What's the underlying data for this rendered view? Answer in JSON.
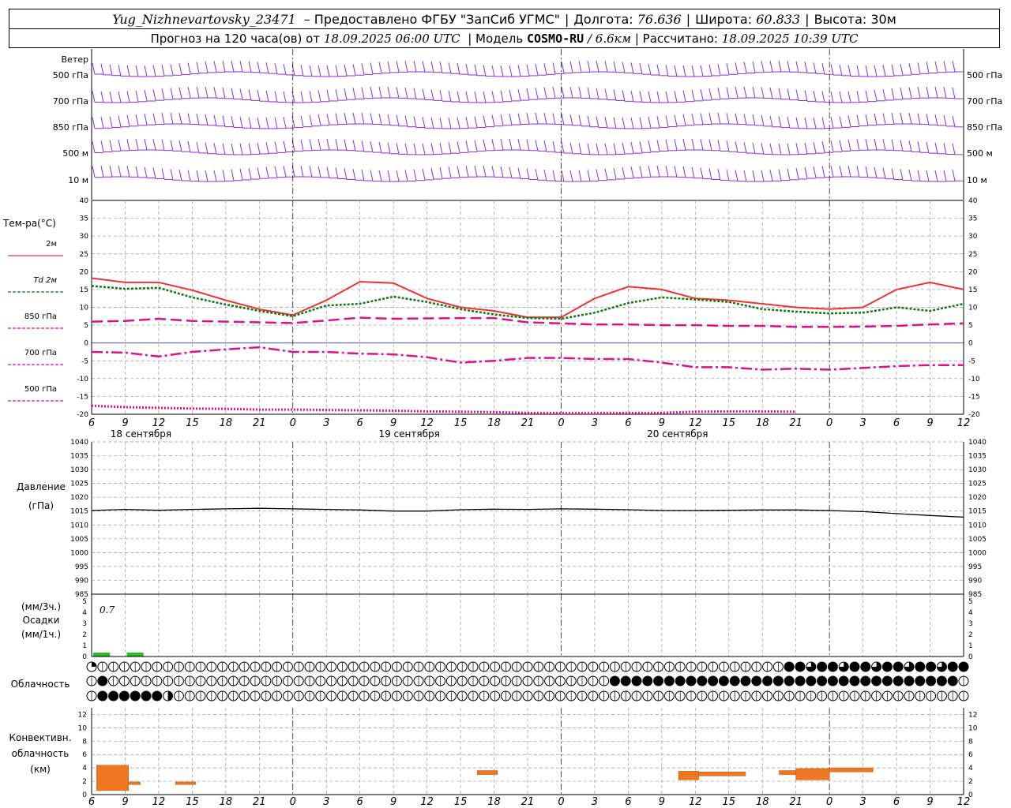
{
  "header": {
    "station": "Yug_Nizhnevartovsky_23471",
    "provider": "– Предоставлено ФГБУ \"ЗапСиб УГМС\"",
    "lon_label": "Долгота:",
    "lon": "76.636",
    "lat_label": "Широта:",
    "lat": "60.833",
    "alt_label": "Высота:",
    "alt": "30м",
    "forecast_prefix": "Прогноз на 120 часа(ов) от",
    "forecast_start": "18.09.2025 06:00 UTC",
    "model_label": "| Модель",
    "model": "COSMO-RU",
    "res": "/ 6.6км",
    "calc_label": "| Рассчитано:",
    "calc": "18.09.2025 10:39 UTC"
  },
  "labels": {
    "wind": "Ветер",
    "wind_levels": [
      "500 гПа",
      "700 гПа",
      "850 гПа",
      "500 м",
      "10  м"
    ],
    "temp_title": "Тем-ра(°C)",
    "temp_series": [
      "2м",
      "Td  2м",
      "850 гПа",
      "700 гПа",
      "500 гПа"
    ],
    "pressure_title": "Давление",
    "pressure_unit": "(гПа)",
    "precip_top": "(мм/3ч.)",
    "precip_mid": "Осадки",
    "precip_bot": "(мм/1ч.)",
    "precip_total": "0.7",
    "cloud": "Облачность",
    "conv1": "Конвективн.",
    "conv2": "облачность",
    "conv3": "(км)"
  },
  "colors": {
    "t2m": "#ee3333",
    "td2m": "#117711",
    "t850": "#dd1188",
    "t700": "#dd1188",
    "t500": "#dd1188",
    "wind": "#8a2be2",
    "precip": "#22bb22",
    "conv": "#ee7722",
    "grid": "#999999"
  },
  "chart_data": {
    "type": "line",
    "x_hours_utc": [
      6,
      9,
      12,
      15,
      18,
      21,
      0,
      3,
      6,
      9,
      12,
      15,
      18,
      21,
      0,
      3,
      6,
      9,
      12,
      15,
      18,
      21,
      0,
      3,
      6,
      9,
      12
    ],
    "x_tick_labels": [
      "6",
      "9",
      "12",
      "15",
      "18",
      "21",
      "0",
      "3",
      "6",
      "9",
      "12",
      "15",
      "18",
      "21",
      "0",
      "3",
      "6",
      "9",
      "12",
      "15",
      "18",
      "21",
      "0",
      "3",
      "6",
      "9",
      "12"
    ],
    "day_labels": [
      "18 сентября",
      "19 сентября",
      "20 сентября"
    ],
    "temperature": {
      "ylim": [
        -20,
        40
      ],
      "yticks": [
        -20,
        -15,
        -10,
        -5,
        0,
        5,
        10,
        15,
        20,
        25,
        30,
        35,
        40
      ],
      "series": [
        {
          "name": "2м",
          "values": [
            18.2,
            17,
            17,
            14.8,
            12,
            9.5,
            7.8,
            12,
            17.2,
            16.8,
            12.5,
            10,
            9,
            7.2,
            7.2,
            12.5,
            15.8,
            15,
            12.5,
            12,
            11,
            10,
            9.5,
            10,
            15,
            17,
            15
          ]
        },
        {
          "name": "Td  2м",
          "values": [
            16,
            15.2,
            15.5,
            12.8,
            10.8,
            9,
            7.5,
            10.5,
            11,
            13,
            11.5,
            9.5,
            8,
            7,
            6.8,
            8.5,
            11.2,
            12.8,
            12.2,
            11.5,
            9.5,
            8.8,
            8.3,
            8.5,
            10,
            9,
            11
          ]
        },
        {
          "name": "850 гПа",
          "values": [
            6,
            6.2,
            6.8,
            6.2,
            6,
            5.8,
            5.6,
            6.3,
            7.1,
            6.8,
            6.9,
            7,
            7,
            5.8,
            5.5,
            5.2,
            5.2,
            5,
            5,
            4.8,
            4.8,
            4.5,
            4.5,
            4.6,
            4.8,
            5.2,
            5.5
          ]
        },
        {
          "name": "700 гПа",
          "values": [
            -2.5,
            -2.7,
            -3.8,
            -2.5,
            -1.8,
            -1.2,
            -2.5,
            -2.5,
            -3,
            -3.2,
            -4,
            -5.5,
            -5,
            -4.2,
            -4.2,
            -4.5,
            -4.5,
            -5.5,
            -6.8,
            -6.8,
            -7.5,
            -7.2,
            -7.5,
            -7,
            -6.5,
            -6.2,
            -6.2
          ]
        },
        {
          "name": "500 гПа",
          "values": [
            -17.6,
            -18,
            -18.2,
            -18.4,
            -18.5,
            -18.7,
            -18.7,
            -18.8,
            -18.9,
            -19,
            -19.2,
            -19.3,
            -19.4,
            -19.6,
            -19.7,
            -19.7,
            -19.6,
            -19.6,
            -19.3,
            -19.2,
            -19.2,
            -19.3,
            null,
            null,
            null,
            null,
            null
          ]
        }
      ]
    },
    "pressure": {
      "ylim": [
        985,
        1040
      ],
      "yticks": [
        985,
        990,
        995,
        1000,
        1005,
        1010,
        1015,
        1020,
        1025,
        1030,
        1035,
        1040
      ],
      "values": [
        1015.2,
        1015.6,
        1015.3,
        1015.6,
        1015.8,
        1016,
        1015.8,
        1015.6,
        1015.4,
        1015,
        1015,
        1015.5,
        1015.7,
        1015.6,
        1015.8,
        1015.7,
        1015.5,
        1015.2,
        1015.2,
        1015.3,
        1015.4,
        1015.4,
        1015.2,
        1014.8,
        1014.1,
        1013.4,
        1012.8
      ]
    },
    "precipitation": {
      "ylim": [
        0,
        5
      ],
      "total_label": "0.7",
      "bars": [
        {
          "x_index": 0,
          "value": 0.35
        },
        {
          "x_index": 1,
          "value": 0.35
        }
      ]
    },
    "cloudiness": {
      "rows": 3,
      "description": "low/mid/high cloud cover symbols per step"
    },
    "convective_cloud": {
      "ylim": [
        0,
        13
      ],
      "yticks": [
        0,
        2,
        4,
        6,
        8,
        10,
        12
      ],
      "blocks": [
        {
          "from": 0.15,
          "to": 1.1,
          "base": 0.6,
          "top": 4.4
        },
        {
          "from": 1.1,
          "to": 1.45,
          "base": 1.5,
          "top": 1.9
        },
        {
          "from": 2.5,
          "to": 3.1,
          "base": 1.5,
          "top": 1.9
        },
        {
          "from": 11.5,
          "to": 12.1,
          "base": 3.0,
          "top": 3.6
        },
        {
          "from": 17.5,
          "to": 18.1,
          "base": 2.2,
          "top": 3.5
        },
        {
          "from": 18.1,
          "to": 19.5,
          "base": 2.8,
          "top": 3.4
        },
        {
          "from": 20.5,
          "to": 21.0,
          "base": 3.0,
          "top": 3.6
        },
        {
          "from": 21.0,
          "to": 22.0,
          "base": 2.2,
          "top": 3.9
        },
        {
          "from": 22.0,
          "to": 23.3,
          "base": 3.4,
          "top": 4.0
        }
      ]
    }
  }
}
